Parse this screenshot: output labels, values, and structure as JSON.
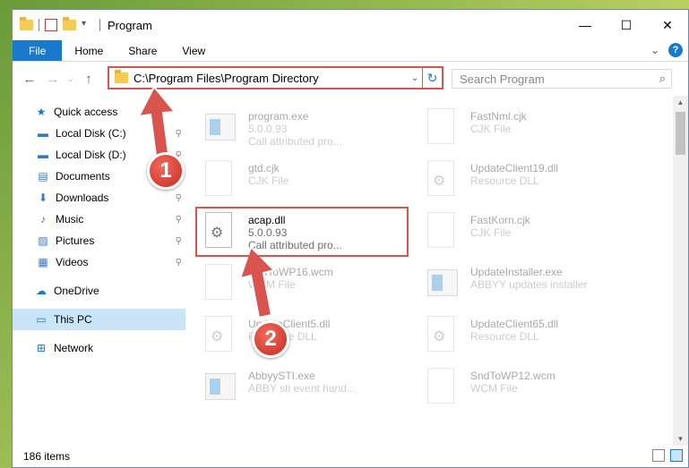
{
  "window": {
    "title": "Program",
    "controls": {
      "minimize": "—",
      "maximize": "☐",
      "close": "✕"
    }
  },
  "ribbon": {
    "tabs": [
      "File",
      "Home",
      "Share",
      "View"
    ],
    "expand": "⌄",
    "help": "?"
  },
  "address": {
    "path": "C:\\Program Files\\Program Directory",
    "refresh": "↻",
    "dropdown": "⌄"
  },
  "search": {
    "placeholder": "Search Program",
    "icon": "⌕"
  },
  "nav_arrows": {
    "back": "←",
    "forward": "→",
    "recent": "⌄",
    "up": "↑"
  },
  "sidebar": {
    "quick_access": "Quick access",
    "items": [
      {
        "label": "Local Disk (C:)",
        "icon": "drive-icon",
        "glyph": "▬"
      },
      {
        "label": "Local Disk (D:)",
        "icon": "drive-icon",
        "glyph": "▬"
      },
      {
        "label": "Documents",
        "icon": "documents-icon",
        "glyph": "▤"
      },
      {
        "label": "Downloads",
        "icon": "downloads-icon",
        "glyph": "⬇"
      },
      {
        "label": "Music",
        "icon": "music-icon",
        "glyph": "♪"
      },
      {
        "label": "Pictures",
        "icon": "pictures-icon",
        "glyph": "▨"
      },
      {
        "label": "Videos",
        "icon": "videos-icon",
        "glyph": "▦"
      }
    ],
    "pin": "📌",
    "onedrive": "OneDrive",
    "this_pc": "This PC",
    "network": "Network"
  },
  "files": [
    {
      "name": "program.exe",
      "line2": "5.0.0.93",
      "line3": "Call attributed pro...",
      "type": "exe"
    },
    {
      "name": "FastNml.cjk",
      "line2": "CJK File",
      "line3": "",
      "type": "doc"
    },
    {
      "name": "gtd.cjk",
      "line2": "CJK File",
      "line3": "",
      "type": "doc"
    },
    {
      "name": "UpdateClient19.dll",
      "line2": "Resource DLL",
      "line3": "",
      "type": "dll"
    },
    {
      "name": "acap.dll",
      "line2": "5.0.0.93",
      "line3": "Call attributed pro...",
      "type": "dll"
    },
    {
      "name": "FastKorn.cjk",
      "line2": "CJK File",
      "line3": "",
      "type": "doc"
    },
    {
      "name": "SndToWP16.wcm",
      "line2": "WCM File",
      "line3": "",
      "type": "doc"
    },
    {
      "name": "UpdateInstaller.exe",
      "line2": "ABBYY updates installer",
      "line3": "",
      "type": "exe"
    },
    {
      "name": "UpdateClient5.dll",
      "line2": "Resource DLL",
      "line3": "",
      "type": "dll"
    },
    {
      "name": "UpdateClient65.dll",
      "line2": "Resource DLL",
      "line3": "",
      "type": "dll"
    },
    {
      "name": "AbbyySTI.exe",
      "line2": "ABBY sti event hand...",
      "line3": "",
      "type": "exe"
    },
    {
      "name": "SndToWP12.wcm",
      "line2": "WCM File",
      "line3": "",
      "type": "doc"
    }
  ],
  "status": {
    "count": "186 items"
  },
  "annotations": {
    "step1": "1",
    "step2": "2",
    "color": "#d9534f"
  }
}
